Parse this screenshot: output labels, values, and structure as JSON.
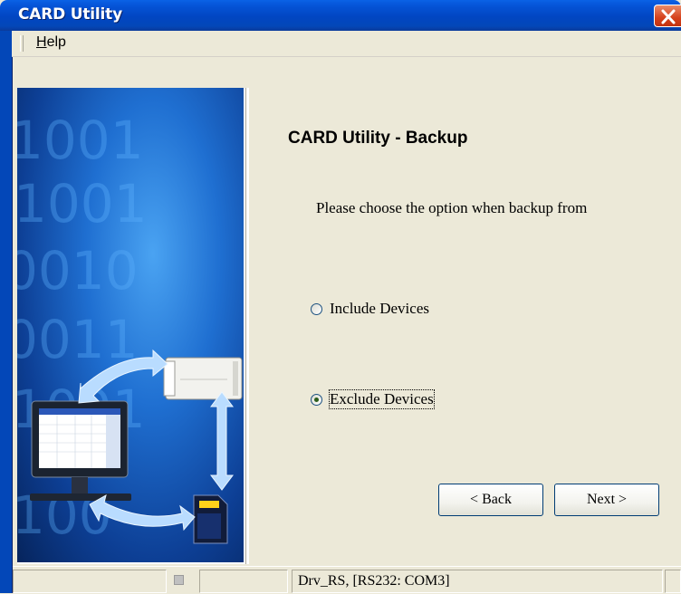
{
  "window": {
    "title": "CARD Utility"
  },
  "menu": {
    "help_label": "Help"
  },
  "wizard": {
    "heading": "CARD Utility - Backup",
    "prompt": "Please choose the option when backup from",
    "options": [
      {
        "label": "Include Devices",
        "checked": false
      },
      {
        "label": "Exclude Devices",
        "checked": true
      }
    ],
    "back_label": "< Back",
    "next_label": "Next >"
  },
  "banner": {
    "binary_text": [
      "1001",
      "1001",
      "0010",
      "0011",
      "1001",
      "100"
    ]
  },
  "statusbar": {
    "driver_text": "Drv_RS, [RS232: COM3]"
  },
  "icons": [
    "close-icon",
    "computer-icon",
    "plc-icon",
    "sd-card-icon",
    "sync-arrows-icon"
  ]
}
